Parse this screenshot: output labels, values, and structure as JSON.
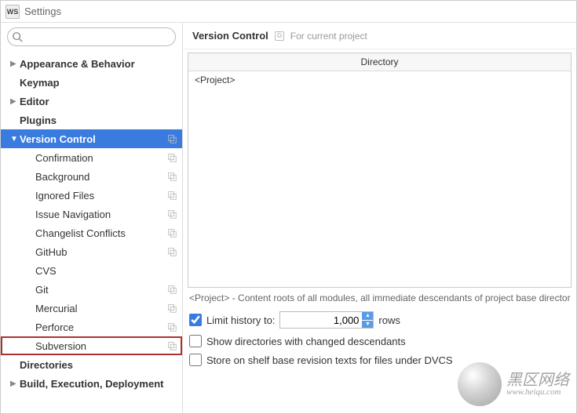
{
  "window": {
    "title": "Settings"
  },
  "sidebar": {
    "search_placeholder": "",
    "items": [
      {
        "label": "Appearance & Behavior",
        "depth": 0,
        "bold": true,
        "chevron": "right",
        "copy": false
      },
      {
        "label": "Keymap",
        "depth": 0,
        "bold": true,
        "copy": false
      },
      {
        "label": "Editor",
        "depth": 0,
        "bold": true,
        "chevron": "right",
        "copy": false
      },
      {
        "label": "Plugins",
        "depth": 0,
        "bold": true,
        "copy": false
      },
      {
        "label": "Version Control",
        "depth": 0,
        "bold": true,
        "chevron": "down",
        "selected": true,
        "copy": true
      },
      {
        "label": "Confirmation",
        "depth": 1,
        "copy": true
      },
      {
        "label": "Background",
        "depth": 1,
        "copy": true
      },
      {
        "label": "Ignored Files",
        "depth": 1,
        "copy": true
      },
      {
        "label": "Issue Navigation",
        "depth": 1,
        "copy": true
      },
      {
        "label": "Changelist Conflicts",
        "depth": 1,
        "copy": true
      },
      {
        "label": "GitHub",
        "depth": 1,
        "copy": true
      },
      {
        "label": "CVS",
        "depth": 1
      },
      {
        "label": "Git",
        "depth": 1,
        "copy": true
      },
      {
        "label": "Mercurial",
        "depth": 1,
        "copy": true
      },
      {
        "label": "Perforce",
        "depth": 1,
        "copy": true
      },
      {
        "label": "Subversion",
        "depth": 1,
        "copy": true,
        "highlighted": true
      },
      {
        "label": "Directories",
        "depth": 0,
        "bold": true
      },
      {
        "label": "Build, Execution, Deployment",
        "depth": 0,
        "bold": true,
        "chevron": "right"
      }
    ]
  },
  "crumb": {
    "title": "Version Control",
    "scope": "For current project"
  },
  "table": {
    "header": "Directory",
    "rows": [
      {
        "directory": "<Project>"
      }
    ]
  },
  "hint": "<Project> - Content roots of all modules, all immediate descendants of project base director",
  "options": {
    "limit_history_label": "Limit history to:",
    "limit_history_value": "1,000",
    "limit_history_checked": true,
    "rows_label": "rows",
    "show_dirs_label": "Show directories with changed descendants",
    "show_dirs_checked": false,
    "store_shelf_label": "Store on shelf base revision texts for files under DVCS",
    "store_shelf_checked": false
  },
  "watermark": {
    "line1": "黑区网络",
    "line2": "www.heiqu.com"
  }
}
